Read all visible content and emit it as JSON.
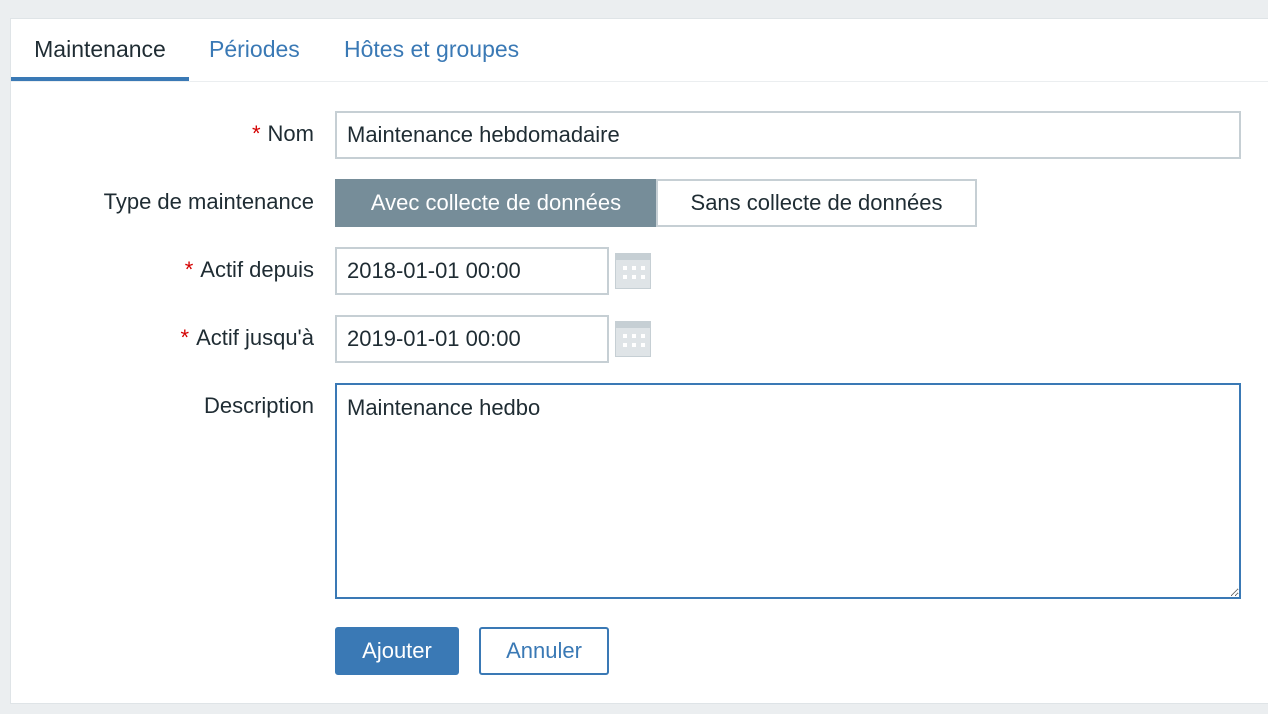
{
  "tabs": [
    {
      "label": "Maintenance",
      "active": true
    },
    {
      "label": "Périodes",
      "active": false
    },
    {
      "label": "Hôtes et groupes",
      "active": false
    }
  ],
  "form": {
    "required_marker": "*",
    "name": {
      "label": "Nom",
      "value": "Maintenance hebdomadaire"
    },
    "type": {
      "label": "Type de maintenance",
      "options": [
        "Avec collecte de données",
        "Sans collecte de données"
      ],
      "selected": "Avec collecte de données"
    },
    "active_since": {
      "label": "Actif depuis",
      "value": "2018-01-01 00:00",
      "icon": "calendar-icon"
    },
    "active_till": {
      "label": "Actif jusqu'à",
      "value": "2019-01-01 00:00",
      "icon": "calendar-icon"
    },
    "description": {
      "label": "Description",
      "value": "Maintenance hedbo"
    }
  },
  "buttons": {
    "add": "Ajouter",
    "cancel": "Annuler"
  },
  "colors": {
    "accent": "#3a79b5",
    "selected_segment": "#768d99",
    "required": "#d40000"
  }
}
